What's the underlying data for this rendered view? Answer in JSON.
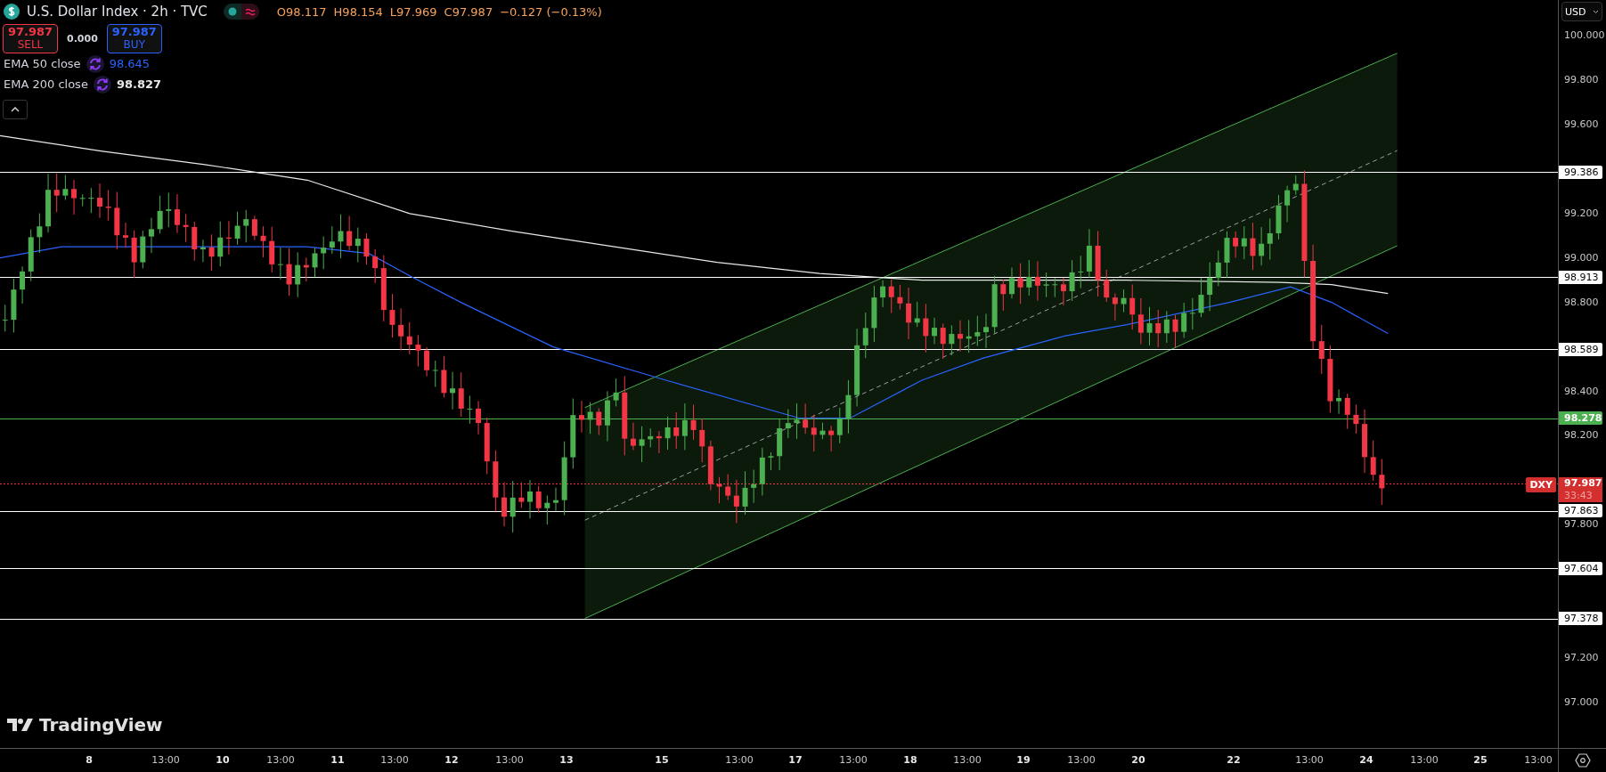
{
  "header": {
    "title": "U.S. Dollar Index · 2h · TVC",
    "open": "O98.117",
    "high": "H98.154",
    "low": "L97.969",
    "close": "C97.987",
    "change": "−0.127 (−0.13%)"
  },
  "trade_buttons": [
    {
      "kind": "sell",
      "price": "97.987",
      "label": "SELL"
    },
    {
      "kind": "spread",
      "price": "0.000"
    },
    {
      "kind": "buy",
      "price": "97.987",
      "label": "BUY"
    }
  ],
  "indicators": [
    {
      "name": "EMA 50 close",
      "value": "98.645",
      "color": "#2962ff"
    },
    {
      "name": "EMA 200 close",
      "value": "98.827",
      "color": "#e8e8e8"
    }
  ],
  "currency": "USD",
  "price_axis": {
    "labels": [
      "100.000",
      "99.800",
      "99.600",
      "99.200",
      "99.000",
      "98.800",
      "98.400",
      "98.200",
      "97.800",
      "97.200",
      "97.000"
    ]
  },
  "levels": [
    {
      "value": "99.386",
      "color": "#ffffff"
    },
    {
      "value": "98.913",
      "color": "#ffffff"
    },
    {
      "value": "98.589",
      "color": "#ffffff"
    },
    {
      "value": "98.278",
      "color": "#4caf50"
    },
    {
      "value": "97.863",
      "color": "#ffffff"
    },
    {
      "value": "97.604",
      "color": "#ffffff"
    },
    {
      "value": "97.378",
      "color": "#ffffff"
    }
  ],
  "last_price": {
    "symbol": "DXY",
    "price": "97.987",
    "countdown": "33:43"
  },
  "time_axis": [
    {
      "label": "8",
      "kind": "date"
    },
    {
      "label": "13:00",
      "kind": "time"
    },
    {
      "label": "10",
      "kind": "date"
    },
    {
      "label": "13:00",
      "kind": "time"
    },
    {
      "label": "11",
      "kind": "date"
    },
    {
      "label": "13:00",
      "kind": "time"
    },
    {
      "label": "12",
      "kind": "date"
    },
    {
      "label": "13:00",
      "kind": "time"
    },
    {
      "label": "13",
      "kind": "date"
    },
    {
      "label": "15",
      "kind": "date"
    },
    {
      "label": "13:00",
      "kind": "time"
    },
    {
      "label": "17",
      "kind": "date"
    },
    {
      "label": "13:00",
      "kind": "time"
    },
    {
      "label": "18",
      "kind": "date"
    },
    {
      "label": "13:00",
      "kind": "time"
    },
    {
      "label": "19",
      "kind": "date"
    },
    {
      "label": "13:00",
      "kind": "time"
    },
    {
      "label": "20",
      "kind": "date"
    },
    {
      "label": "22",
      "kind": "date"
    },
    {
      "label": "13:00",
      "kind": "time"
    },
    {
      "label": "24",
      "kind": "date"
    },
    {
      "label": "13:00",
      "kind": "time"
    },
    {
      "label": "25",
      "kind": "date"
    },
    {
      "label": "13:00",
      "kind": "time"
    }
  ],
  "logo": "TradingView"
}
